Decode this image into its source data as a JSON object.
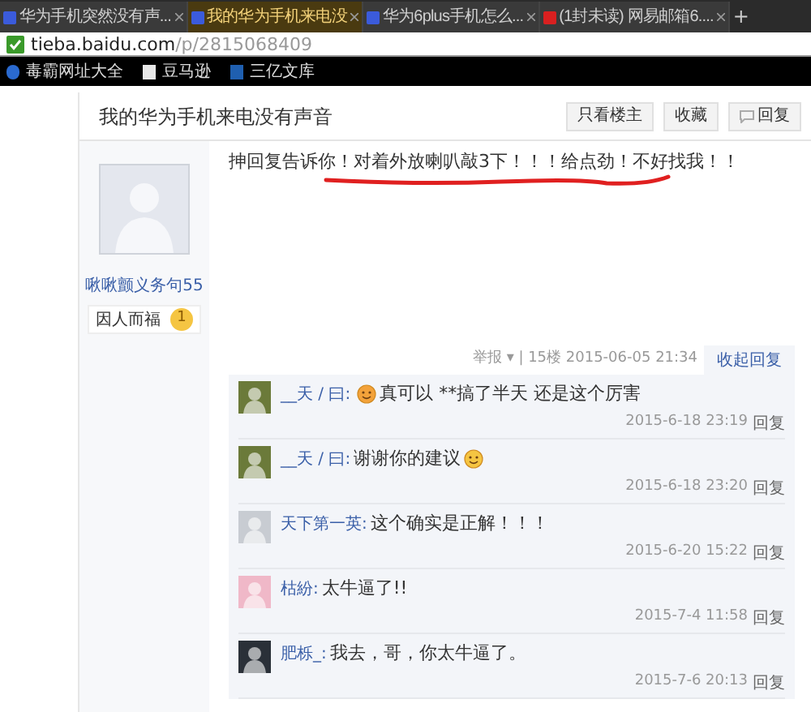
{
  "tabs": [
    {
      "title": "华为手机突然没有声...",
      "selected": false,
      "color": "#3b5bdb"
    },
    {
      "title": "我的华为手机来电没",
      "selected": true,
      "color": "#3b5bdb"
    },
    {
      "title": "华为6plus手机怎么...",
      "selected": false,
      "color": "#3b5bdb"
    },
    {
      "title": "(1封未读) 网易邮箱6....",
      "selected": false,
      "color": "#d92020"
    }
  ],
  "new_tab": "+",
  "address": {
    "host": "tieba.baidu.com",
    "path": "/p/2815068409"
  },
  "bookmarks": [
    "毒霸网址大全",
    "豆马逊",
    "三亿文库"
  ],
  "thread": {
    "title": "我的华为手机来电没有声音",
    "buttons": [
      "只看楼主",
      "收藏",
      "回复"
    ]
  },
  "post": {
    "author": "啾啾颤义务句55",
    "title": "因人而福",
    "level_badge": "1",
    "text": "抻回复告诉你！对着外放喇叭敲3下！！！给点劲！不好找我！！",
    "meta": "举报 ▾ | 15楼 2015-06-05 21:34",
    "collapse": "收起回复"
  },
  "comments": [
    {
      "user": "__天 / 曰:",
      "text": "真可以 **搞了半天 还是这个厉害",
      "leading_emoji": true,
      "time": "2015-6-18 23:19",
      "reply": "回复"
    },
    {
      "user": "__天 / 曰:",
      "text": "谢谢你的建议",
      "trailing_emoji": true,
      "time": "2015-6-18 23:20",
      "reply": "回复"
    },
    {
      "user": "天下第一英:",
      "text": "这个确实是正解！！！",
      "time": "2015-6-20 15:22",
      "reply": "回复"
    },
    {
      "user": "枯紛:",
      "text": "太牛逼了!!",
      "time": "2015-7-4 11:58",
      "reply": "回复"
    },
    {
      "user": "肥栎_:",
      "text": "我去，哥，你太牛逼了。",
      "time": "2015-7-6 20:13",
      "reply": "回复"
    }
  ]
}
